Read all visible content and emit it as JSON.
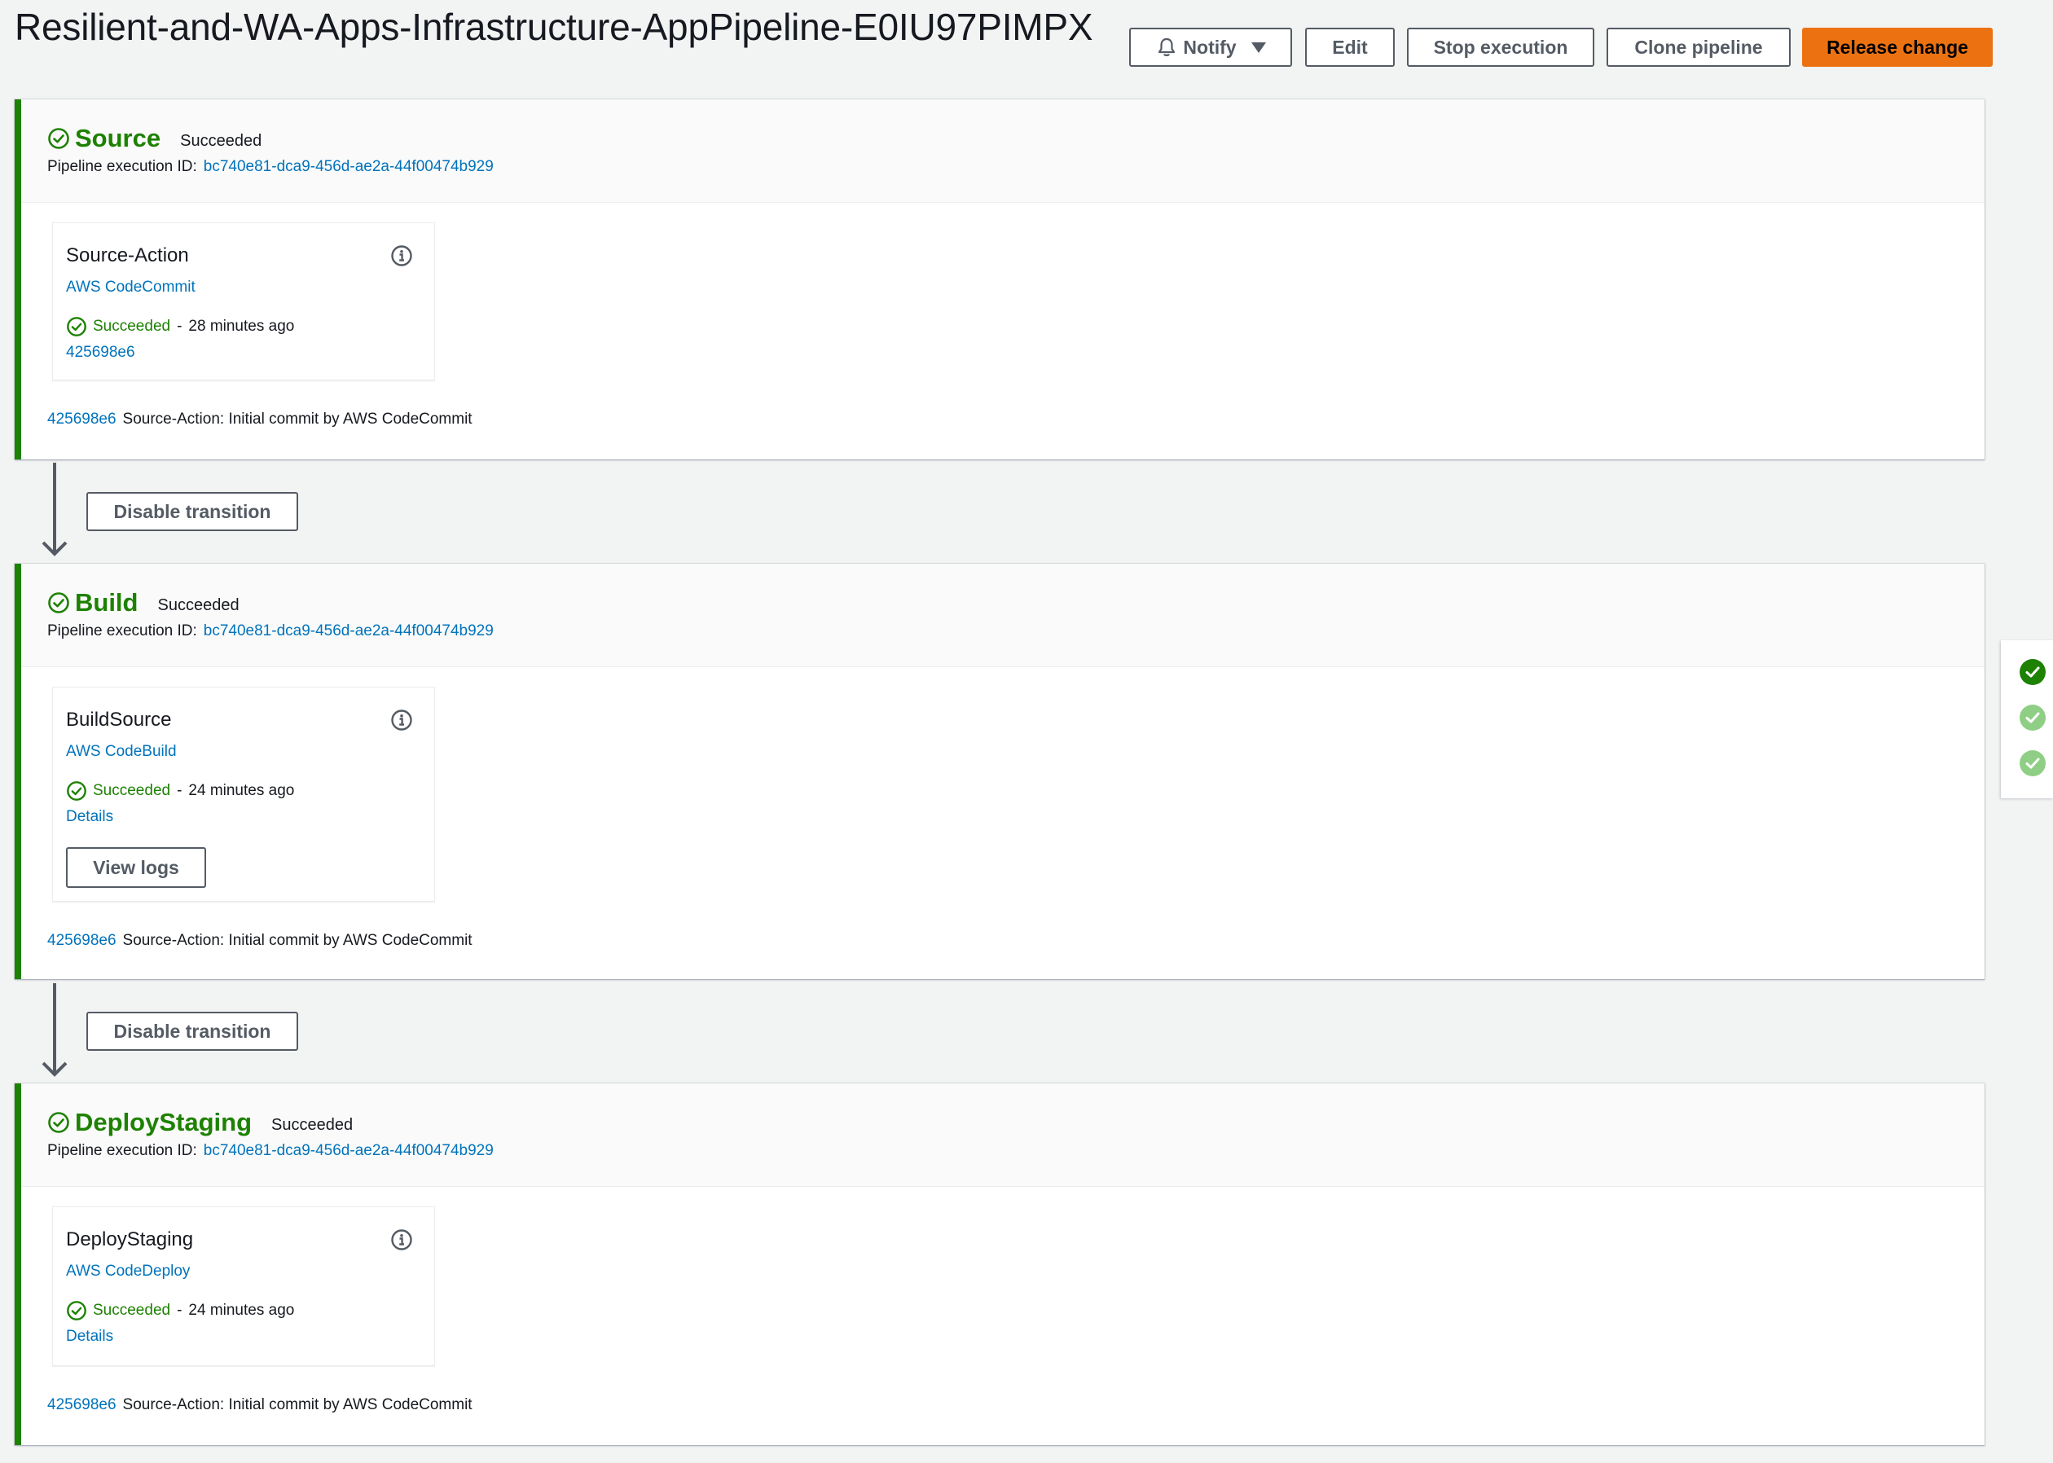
{
  "pipeline": {
    "title": "Resilient-and-WA-Apps-Infrastructure-AppPipeline-E0IU97PIMPX"
  },
  "toolbar": {
    "notify": "Notify",
    "edit": "Edit",
    "stop": "Stop execution",
    "clone": "Clone pipeline",
    "release": "Release change"
  },
  "colors": {
    "success": "#1d8102",
    "link": "#0073bb",
    "primary": "#ec7211"
  },
  "stages": [
    {
      "name": "Source",
      "status": "Succeeded",
      "exec_label": "Pipeline execution ID:",
      "exec_id": "bc740e81-dca9-456d-ae2a-44f00474b929",
      "action": {
        "name": "Source-Action",
        "provider": "AWS CodeCommit",
        "status": "Succeeded",
        "sep": "-",
        "time": "28 minutes ago",
        "link": "425698e6"
      },
      "commit_id": "425698e6",
      "commit_msg": "Source-Action: Initial commit by AWS CodeCommit"
    },
    {
      "name": "Build",
      "status": "Succeeded",
      "exec_label": "Pipeline execution ID:",
      "exec_id": "bc740e81-dca9-456d-ae2a-44f00474b929",
      "action": {
        "name": "BuildSource",
        "provider": "AWS CodeBuild",
        "status": "Succeeded",
        "sep": "-",
        "time": "24 minutes ago",
        "link": "Details",
        "button": "View logs"
      },
      "commit_id": "425698e6",
      "commit_msg": "Source-Action: Initial commit by AWS CodeCommit"
    },
    {
      "name": "DeployStaging",
      "status": "Succeeded",
      "exec_label": "Pipeline execution ID:",
      "exec_id": "bc740e81-dca9-456d-ae2a-44f00474b929",
      "action": {
        "name": "DeployStaging",
        "provider": "AWS CodeDeploy",
        "status": "Succeeded",
        "sep": "-",
        "time": "24 minutes ago",
        "link": "Details"
      },
      "commit_id": "425698e6",
      "commit_msg": "Source-Action: Initial commit by AWS CodeCommit"
    }
  ],
  "transitions": [
    {
      "label": "Disable transition"
    },
    {
      "label": "Disable transition"
    }
  ]
}
